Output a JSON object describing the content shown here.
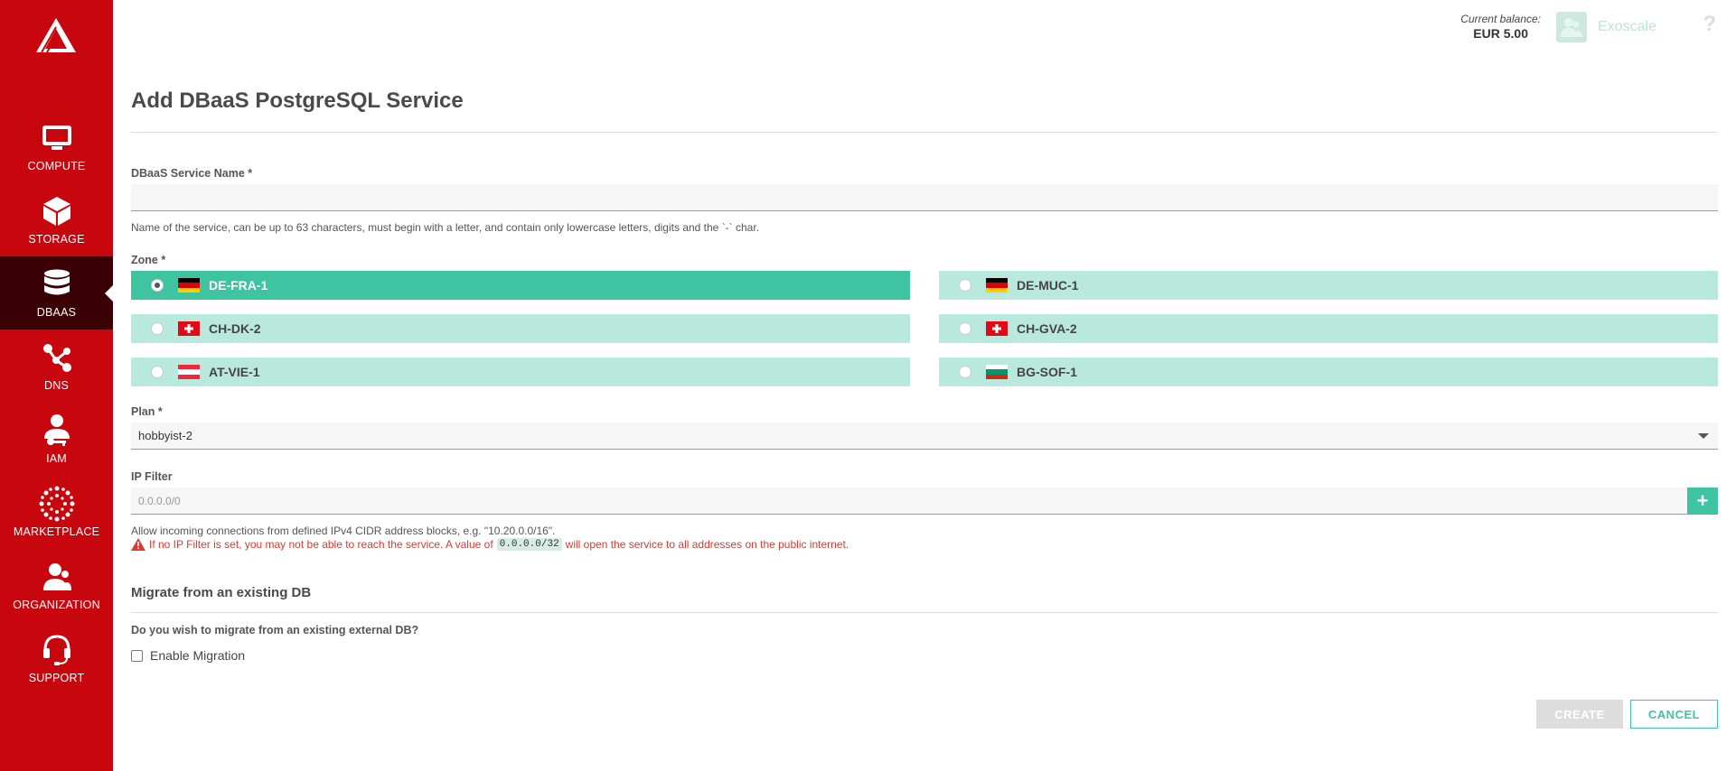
{
  "sidebar": {
    "items": [
      {
        "label": "COMPUTE",
        "icon": "monitor-icon"
      },
      {
        "label": "STORAGE",
        "icon": "cube-icon"
      },
      {
        "label": "DBAAS",
        "icon": "database-icon",
        "active": true
      },
      {
        "label": "DNS",
        "icon": "network-icon"
      },
      {
        "label": "IAM",
        "icon": "user-key-icon"
      },
      {
        "label": "MARKETPLACE",
        "icon": "dots-circle-icon"
      },
      {
        "label": "ORGANIZATION",
        "icon": "users-icon"
      },
      {
        "label": "SUPPORT",
        "icon": "headset-icon"
      }
    ]
  },
  "header": {
    "balance_label": "Current balance:",
    "balance_value": "EUR 5.00",
    "user_name": "Exoscale",
    "help": "?"
  },
  "form": {
    "title": "Add DBaaS PostgreSQL Service",
    "service_name_label": "DBaaS Service Name *",
    "service_name_value": "",
    "service_name_help": "Name of the service, can be up to 63 characters, must begin with a letter, and contain only lowercase letters, digits and the `-` char.",
    "zone_label": "Zone *",
    "zones": [
      {
        "label": "DE-FRA-1",
        "flag": "de",
        "selected": true
      },
      {
        "label": "DE-MUC-1",
        "flag": "de",
        "selected": false
      },
      {
        "label": "CH-DK-2",
        "flag": "ch",
        "selected": false
      },
      {
        "label": "CH-GVA-2",
        "flag": "ch",
        "selected": false
      },
      {
        "label": "AT-VIE-1",
        "flag": "at",
        "selected": false
      },
      {
        "label": "BG-SOF-1",
        "flag": "bg",
        "selected": false
      }
    ],
    "plan_label": "Plan *",
    "plan_value": "hobbyist-2",
    "ip_filter_label": "IP Filter",
    "ip_filter_placeholder": "0.0.0.0/0",
    "ip_filter_help": "Allow incoming connections from defined IPv4 CIDR address blocks, e.g. \"10.20.0.0/16\".",
    "warning_before": "If no IP Filter is set, you may not be able to reach the service. A value of",
    "warning_code": "0.0.0.0/32",
    "warning_after": "will open the service to all addresses on the public internet.",
    "migrate_title": "Migrate from an existing DB",
    "migrate_question": "Do you wish to migrate from an existing external DB?",
    "migrate_checkbox_label": "Enable Migration",
    "create_label": "CREATE",
    "cancel_label": "CANCEL"
  },
  "colors": {
    "sidebar": "#c8060e",
    "sidebar_active": "#3b0004",
    "accent": "#3fc4a1",
    "zone_bg": "#b9e9dc",
    "warning": "#d83b2f"
  }
}
